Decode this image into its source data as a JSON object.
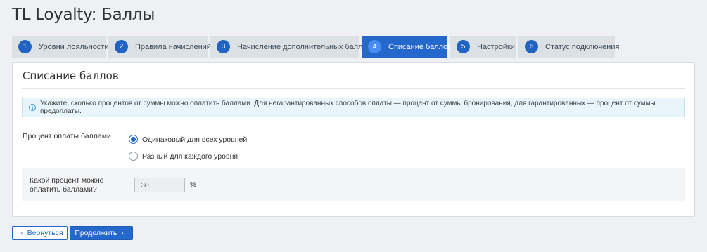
{
  "page_title": "TL Loyalty: Баллы",
  "tabs": [
    {
      "num": "1",
      "label": "Уровни лояльности"
    },
    {
      "num": "2",
      "label": "Правила начислений"
    },
    {
      "num": "3",
      "label": "Начисление дополнительных баллов"
    },
    {
      "num": "4",
      "label": "Списание баллов"
    },
    {
      "num": "5",
      "label": "Настройки"
    },
    {
      "num": "6",
      "label": "Статус подключения"
    }
  ],
  "active_tab": 4,
  "card": {
    "title": "Списание баллов",
    "info_icon": "info-icon",
    "info_text": "Укажите, сколько процентов от суммы можно оплатить баллами. Для негарантированных способов оплаты — процент от суммы бронирования, для гарантированных — процент от суммы предоплаты.",
    "payment_label": "Процент оплаты баллами",
    "options": [
      {
        "label": "Одинаковый для всех уровней",
        "checked": true
      },
      {
        "label": "Разный для каждого уровня",
        "checked": false
      }
    ],
    "percent_label": "Какой процент можно оплатить баллами?",
    "percent_value": "30",
    "percent_unit": "%"
  },
  "buttons": {
    "back_label": "Вернуться",
    "next_label": "Продолжить"
  },
  "colors": {
    "accent": "#2468cc",
    "tab_inactive": "#dce1e6",
    "info_bg": "#e8f5fb",
    "page_bg": "#eef0f3"
  }
}
